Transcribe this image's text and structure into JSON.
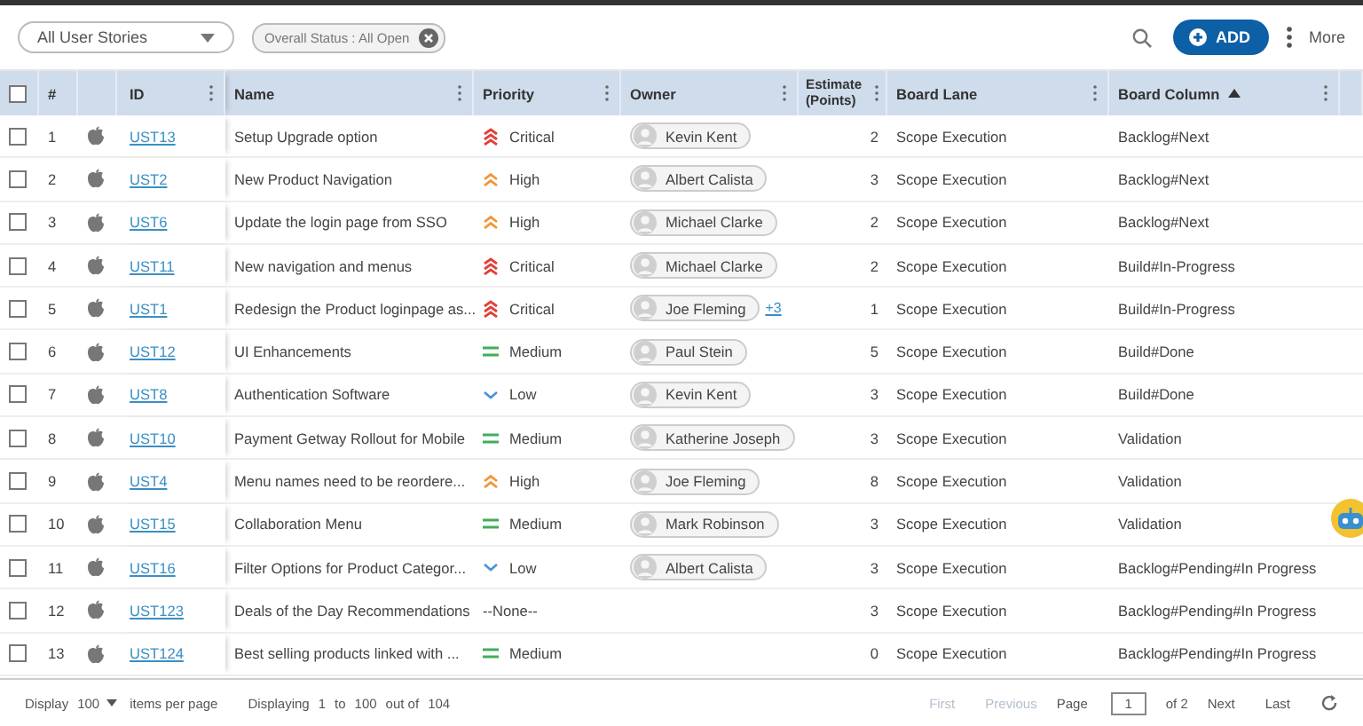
{
  "toolbar": {
    "view_select": "All User Stories",
    "filter_chip": "Overall Status : All Open",
    "add_button": "ADD",
    "more": "More"
  },
  "table": {
    "select_all_checked": false,
    "columns": [
      {
        "label": "#",
        "menu": false,
        "sorted": false
      },
      {
        "label": "ID",
        "menu": true,
        "sorted": false
      },
      {
        "label": "Name",
        "menu": true,
        "sorted": false
      },
      {
        "label": "Priority",
        "menu": true,
        "sorted": false
      },
      {
        "label": "Owner",
        "menu": true,
        "sorted": false
      },
      {
        "label": "Estimate (Points)",
        "menu": true,
        "sorted": false
      },
      {
        "label": "Board Lane",
        "menu": true,
        "sorted": false
      },
      {
        "label": "Board Column",
        "menu": true,
        "sorted": true
      }
    ],
    "rows": [
      {
        "checked": false,
        "num": "1",
        "id": "UST13",
        "name": "Setup Upgrade option",
        "priority": {
          "kind": "critical",
          "label": "Critical"
        },
        "owner": {
          "name": "Kevin Kent"
        },
        "estimate": "2",
        "lane": "Scope Execution",
        "column": "Backlog#Next"
      },
      {
        "checked": false,
        "num": "2",
        "id": "UST2",
        "name": "New Product Navigation",
        "priority": {
          "kind": "high",
          "label": "High"
        },
        "owner": {
          "name": "Albert Calista"
        },
        "estimate": "3",
        "lane": "Scope Execution",
        "column": "Backlog#Next"
      },
      {
        "checked": false,
        "num": "3",
        "id": "UST6",
        "name": "Update the login page from SSO",
        "priority": {
          "kind": "high",
          "label": "High"
        },
        "owner": {
          "name": "Michael Clarke"
        },
        "estimate": "2",
        "lane": "Scope Execution",
        "column": "Backlog#Next"
      },
      {
        "checked": false,
        "num": "4",
        "id": "UST11",
        "name": "New navigation and menus",
        "priority": {
          "kind": "critical",
          "label": "Critical"
        },
        "owner": {
          "name": "Michael Clarke"
        },
        "estimate": "2",
        "lane": "Scope Execution",
        "column": "Build#In-Progress"
      },
      {
        "checked": false,
        "num": "5",
        "id": "UST1",
        "name": "Redesign the Product loginpage as...",
        "priority": {
          "kind": "critical",
          "label": "Critical"
        },
        "owner": {
          "name": "Joe Fleming",
          "more": "+3"
        },
        "estimate": "1",
        "lane": "Scope Execution",
        "column": "Build#In-Progress"
      },
      {
        "checked": false,
        "num": "6",
        "id": "UST12",
        "name": "UI Enhancements",
        "priority": {
          "kind": "medium",
          "label": "Medium"
        },
        "owner": {
          "name": "Paul Stein"
        },
        "estimate": "5",
        "lane": "Scope Execution",
        "column": "Build#Done"
      },
      {
        "checked": false,
        "num": "7",
        "id": "UST8",
        "name": "Authentication Software",
        "priority": {
          "kind": "low",
          "label": "Low"
        },
        "owner": {
          "name": "Kevin Kent"
        },
        "estimate": "3",
        "lane": "Scope Execution",
        "column": "Build#Done"
      },
      {
        "checked": false,
        "num": "8",
        "id": "UST10",
        "name": "Payment Getway Rollout for Mobile",
        "priority": {
          "kind": "medium",
          "label": "Medium"
        },
        "owner": {
          "name": "Katherine Joseph"
        },
        "estimate": "3",
        "lane": "Scope Execution",
        "column": "Validation"
      },
      {
        "checked": false,
        "num": "9",
        "id": "UST4",
        "name": "Menu names need to be reordere...",
        "priority": {
          "kind": "high",
          "label": "High"
        },
        "owner": {
          "name": "Joe Fleming"
        },
        "estimate": "8",
        "lane": "Scope Execution",
        "column": "Validation"
      },
      {
        "checked": false,
        "num": "10",
        "id": "UST15",
        "name": "Collaboration Menu",
        "priority": {
          "kind": "medium",
          "label": "Medium"
        },
        "owner": {
          "name": "Mark Robinson"
        },
        "estimate": "3",
        "lane": "Scope Execution",
        "column": "Validation"
      },
      {
        "checked": false,
        "num": "11",
        "id": "UST16",
        "name": "Filter Options for Product Categor...",
        "priority": {
          "kind": "low",
          "label": "Low"
        },
        "owner": {
          "name": "Albert Calista"
        },
        "estimate": "3",
        "lane": "Scope Execution",
        "column": "Backlog#Pending#In Progress"
      },
      {
        "checked": false,
        "num": "12",
        "id": "UST123",
        "name": "Deals of the Day Recommendations",
        "priority": {
          "kind": "none",
          "label": "--None--"
        },
        "estimate": "3",
        "lane": "Scope Execution",
        "column": "Backlog#Pending#In Progress"
      },
      {
        "checked": false,
        "num": "13",
        "id": "UST124",
        "name": "Best selling products linked with ...",
        "priority": {
          "kind": "medium",
          "label": "Medium"
        },
        "estimate": "0",
        "lane": "Scope Execution",
        "column": "Backlog#Pending#In Progress"
      }
    ]
  },
  "footer": {
    "display": "Display",
    "page_size": "100",
    "per_page": "items per page",
    "displaying": "Displaying",
    "from": "1",
    "to_label": "to",
    "to": "100",
    "out_of": "out of",
    "total": "104",
    "pager": [
      {
        "label": "First",
        "disabled": true
      },
      {
        "label": "Previous",
        "disabled": true
      }
    ],
    "page_label": "Page",
    "page": "1",
    "of": "of 2",
    "pager_next": [
      {
        "label": "Next",
        "disabled": false
      },
      {
        "label": "Last",
        "disabled": false
      }
    ]
  }
}
